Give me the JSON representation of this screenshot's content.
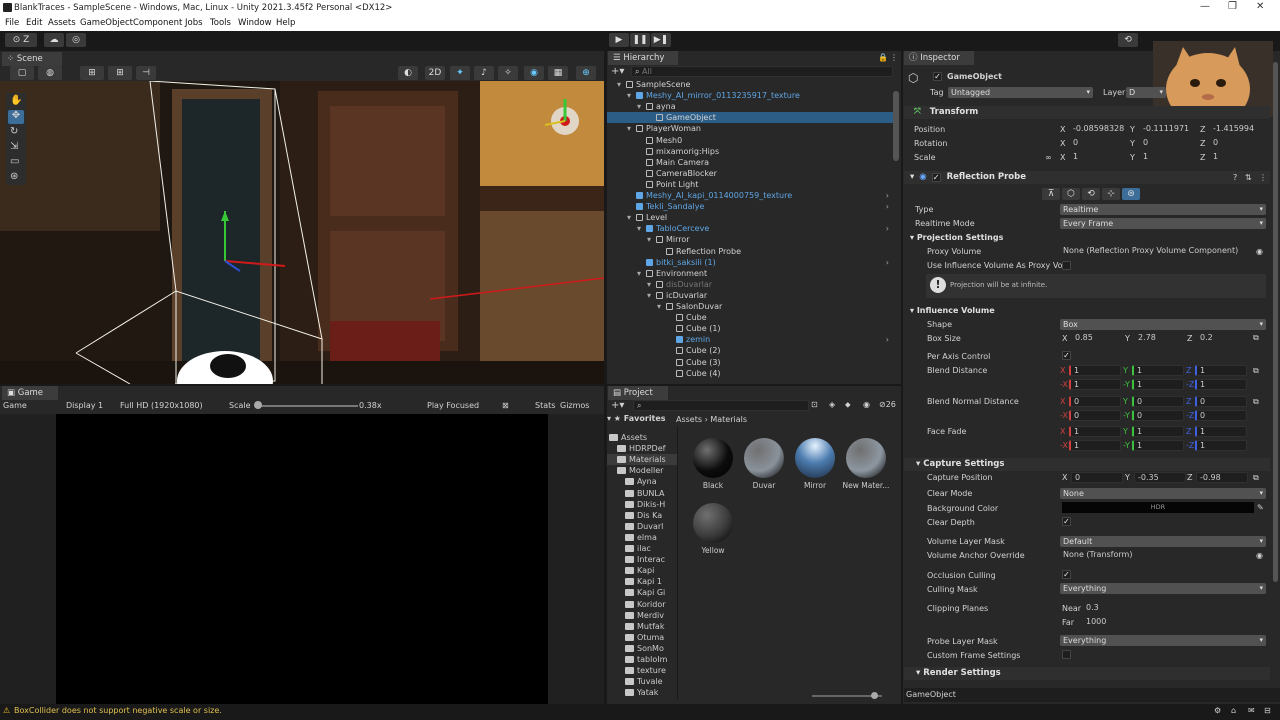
{
  "window": {
    "title": "BlankTraces - SampleScene - Windows, Mac, Linux - Unity 2021.3.45f2 Personal <DX12>",
    "minimize": "—",
    "maximize": "❐",
    "close": "✕"
  },
  "menu": [
    "File",
    "Edit",
    "Assets",
    "GameObject",
    "Component",
    "Jobs",
    "Tools",
    "Window",
    "Help"
  ],
  "toolbar": {
    "account": "Z",
    "play": "▶",
    "pause": "❚❚",
    "step": "▶❚"
  },
  "scene": {
    "tab": "Scene",
    "mode2d": "2D"
  },
  "game": {
    "tab": "Game",
    "display_select": "Game",
    "display": "Display 1",
    "resolution": "Full HD (1920x1080)",
    "scale_label": "Scale",
    "scale_value": "0.38x",
    "play_focused": "Play Focused",
    "stats": "Stats",
    "gizmos": "Gizmos"
  },
  "hierarchy": {
    "tab": "Hierarchy",
    "search_placeholder": "All",
    "rows": [
      {
        "label": "SampleScene",
        "depth": 0,
        "kind": "scene"
      },
      {
        "label": "Meshy_AI_mirror_0113235917_texture",
        "depth": 1,
        "kind": "prefab"
      },
      {
        "label": "ayna",
        "depth": 2,
        "kind": "obj"
      },
      {
        "label": "GameObject",
        "depth": 3,
        "kind": "obj"
      },
      {
        "label": "PlayerWoman",
        "depth": 1,
        "kind": "obj"
      },
      {
        "label": "Mesh0",
        "depth": 2,
        "kind": "obj"
      },
      {
        "label": "mixamorig:Hips",
        "depth": 2,
        "kind": "obj"
      },
      {
        "label": "Main Camera",
        "depth": 2,
        "kind": "obj"
      },
      {
        "label": "CameraBlocker",
        "depth": 2,
        "kind": "obj"
      },
      {
        "label": "Point Light",
        "depth": 2,
        "kind": "obj"
      },
      {
        "label": "Meshy_AI_kapi_0114000759_texture",
        "depth": 1,
        "kind": "prefab"
      },
      {
        "label": "Tekli_Sandalye",
        "depth": 1,
        "kind": "prefab"
      },
      {
        "label": "Level",
        "depth": 1,
        "kind": "obj"
      },
      {
        "label": "TabloCerceve",
        "depth": 2,
        "kind": "prefab"
      },
      {
        "label": "Mirror",
        "depth": 3,
        "kind": "obj"
      },
      {
        "label": "Reflection Probe",
        "depth": 4,
        "kind": "obj"
      },
      {
        "label": "bitki_saksili (1)",
        "depth": 2,
        "kind": "prefab"
      },
      {
        "label": "Environment",
        "depth": 2,
        "kind": "obj"
      },
      {
        "label": "disDuvarlar",
        "depth": 3,
        "kind": "dim"
      },
      {
        "label": "icDuvarlar",
        "depth": 3,
        "kind": "obj"
      },
      {
        "label": "SalonDuvar",
        "depth": 4,
        "kind": "obj"
      },
      {
        "label": "Cube",
        "depth": 5,
        "kind": "obj"
      },
      {
        "label": "Cube (1)",
        "depth": 5,
        "kind": "obj"
      },
      {
        "label": "zemin",
        "depth": 5,
        "kind": "prefab"
      },
      {
        "label": "Cube (2)",
        "depth": 5,
        "kind": "obj"
      },
      {
        "label": "Cube (3)",
        "depth": 5,
        "kind": "obj"
      },
      {
        "label": "Cube (4)",
        "depth": 5,
        "kind": "obj"
      }
    ]
  },
  "project": {
    "tab": "Project",
    "favorites": "Favorites",
    "breadcrumb_root": "Assets",
    "breadcrumb_sep": "›",
    "breadcrumb_leaf": "Materials",
    "count": "26",
    "tree": [
      "Assets",
      "HDRPDef",
      "Materials",
      "Modeller",
      "Ayna",
      "BUNLA",
      "Dikis-H",
      "Dis Ka",
      "Duvarl",
      "elma",
      "ilac",
      "Interac",
      "Kapi",
      "Kapi 1",
      "Kapi Gi",
      "Koridor",
      "Merdiv",
      "Mutfak",
      "Otuma",
      "SonMo",
      "tabloIm",
      "texture",
      "Tuvale",
      "Yatak"
    ],
    "materials": [
      {
        "name": "Black",
        "color": "#0c0c0c"
      },
      {
        "name": "Duvar",
        "color": "#8a929b"
      },
      {
        "name": "Mirror",
        "color": "#4d7db0"
      },
      {
        "name": "New Mater...",
        "color": "#8d96a0"
      },
      {
        "name": "Yellow",
        "color": "#3b3b3b"
      }
    ]
  },
  "inspector": {
    "tab": "Inspector",
    "object_name": "GameObject",
    "tag_label": "Tag",
    "tag_value": "Untagged",
    "layer_label": "Layer",
    "layer_value": "D",
    "transform": {
      "title": "Transform",
      "position_label": "Position",
      "rotation_label": "Rotation",
      "scale_label": "Scale",
      "pos_x": "-0.08598328",
      "pos_y": "-0.1111971",
      "pos_z": "-1.415994",
      "rot_x": "0",
      "rot_y": "0",
      "rot_z": "0",
      "scale_x": "1",
      "scale_y": "1",
      "scale_z": "1"
    },
    "probe": {
      "title": "Reflection Probe",
      "type_label": "Type",
      "type_value": "Realtime",
      "mode_label": "Realtime Mode",
      "mode_value": "Every Frame",
      "projection_settings": "Projection Settings",
      "proxy_label": "Proxy Volume",
      "proxy_value": "None (Reflection Proxy Volume Component)",
      "use_influence_label": "Use Influence Volume As Proxy Volu",
      "info_text": "Projection will be at infinite.",
      "influence_volume": "Influence Volume",
      "shape_label": "Shape",
      "shape_value": "Box",
      "box_size_label": "Box Size",
      "box_x": "0.85",
      "box_y": "2.78",
      "box_z": "0.2",
      "per_axis_label": "Per Axis Control",
      "blend_distance_label": "Blend Distance",
      "blend_normal_label": "Blend Normal Distance",
      "face_fade_label": "Face Fade",
      "bd_x": "1",
      "bd_y": "1",
      "bd_z": "1",
      "bd_nx": "1",
      "bd_ny": "1",
      "bd_nz": "1",
      "bn_x": "0",
      "bn_y": "0",
      "bn_z": "0",
      "bn_nx": "0",
      "bn_ny": "0",
      "bn_nz": "0",
      "ff_x": "1",
      "ff_y": "1",
      "ff_z": "1",
      "ff_nx": "1",
      "ff_ny": "1",
      "ff_nz": "1",
      "capture_settings": "Capture Settings",
      "capture_pos_label": "Capture Position",
      "cap_x": "0",
      "cap_y": "-0.35",
      "cap_z": "-0.98",
      "clear_mode_label": "Clear Mode",
      "clear_mode_value": "None",
      "bg_color_label": "Background Color",
      "bg_color_text": "HDR",
      "clear_depth_label": "Clear Depth",
      "volume_mask_label": "Volume Layer Mask",
      "volume_mask_value": "Default",
      "anchor_label": "Volume Anchor Override",
      "anchor_value": "None (Transform)",
      "occlusion_label": "Occlusion Culling",
      "culling_mask_label": "Culling Mask",
      "culling_mask_value": "Everything",
      "clipping_label": "Clipping Planes",
      "near_label": "Near",
      "near_value": "0.3",
      "far_label": "Far",
      "far_value": "1000",
      "probe_layer_label": "Probe Layer Mask",
      "probe_layer_value": "Everything",
      "custom_frame_label": "Custom Frame Settings",
      "render_settings": "Render Settings"
    },
    "footer": "GameObject"
  },
  "status": {
    "warning": "BoxCollider does not support negative scale or size."
  },
  "axis": {
    "x": "X",
    "y": "Y",
    "z": "Z",
    "nx": "-X",
    "ny": "-Y",
    "nz": "-Z"
  }
}
